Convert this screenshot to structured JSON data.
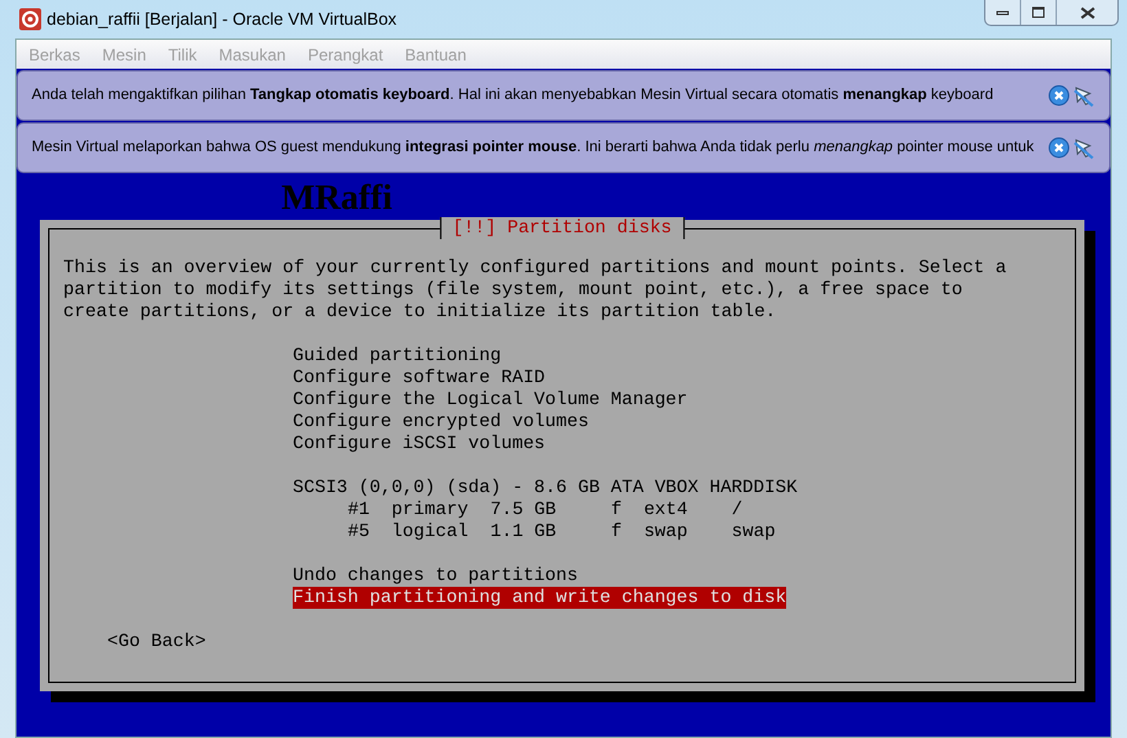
{
  "window": {
    "title": "debian_raffii [Berjalan] - Oracle VM VirtualBox"
  },
  "menu_bar": [
    "Berkas",
    "Mesin",
    "Tilik",
    "Masukan",
    "Perangkat",
    "Bantuan"
  ],
  "notifications": [
    {
      "text": "Anda telah mengaktifkan pilihan **Tangkap otomatis keyboard**. Hal ini akan menyebabkan Mesin Virtual secara otomatis **menangkap** keyboard"
    },
    {
      "text": "Mesin Virtual melaporkan bahwa OS guest mendukung **integrasi pointer mouse**. Ini berarti bahwa Anda tidak perlu *menangkap* pointer mouse untuk"
    }
  ],
  "vm_screen": {
    "banner": "MRaffi",
    "dialog": {
      "title": "[!!] Partition disks",
      "description": "This is an overview of your currently configured partitions and mount points. Select a partition to modify its settings (file system, mount point, etc.), a free space to create partitions, or a device to initialize its partition table.",
      "groups": [
        {
          "items": [
            {
              "text": "Guided partitioning",
              "selected": false
            },
            {
              "text": "Configure software RAID",
              "selected": false
            },
            {
              "text": "Configure the Logical Volume Manager",
              "selected": false
            },
            {
              "text": "Configure encrypted volumes",
              "selected": false
            },
            {
              "text": "Configure iSCSI volumes",
              "selected": false
            }
          ]
        },
        {
          "items": [
            {
              "text": "SCSI3 (0,0,0) (sda) - 8.6 GB ATA VBOX HARDDISK",
              "selected": false,
              "children": [
                {
                  "text": "#1  primary  7.5 GB     f  ext4    /",
                  "selected": false
                },
                {
                  "text": "#5  logical  1.1 GB     f  swap    swap",
                  "selected": false
                }
              ]
            }
          ]
        },
        {
          "items": [
            {
              "text": "Undo changes to partitions",
              "selected": false
            },
            {
              "text": "Finish partitioning and write changes to disk",
              "selected": true
            }
          ]
        }
      ],
      "go_back": "<Go Back>"
    }
  }
}
